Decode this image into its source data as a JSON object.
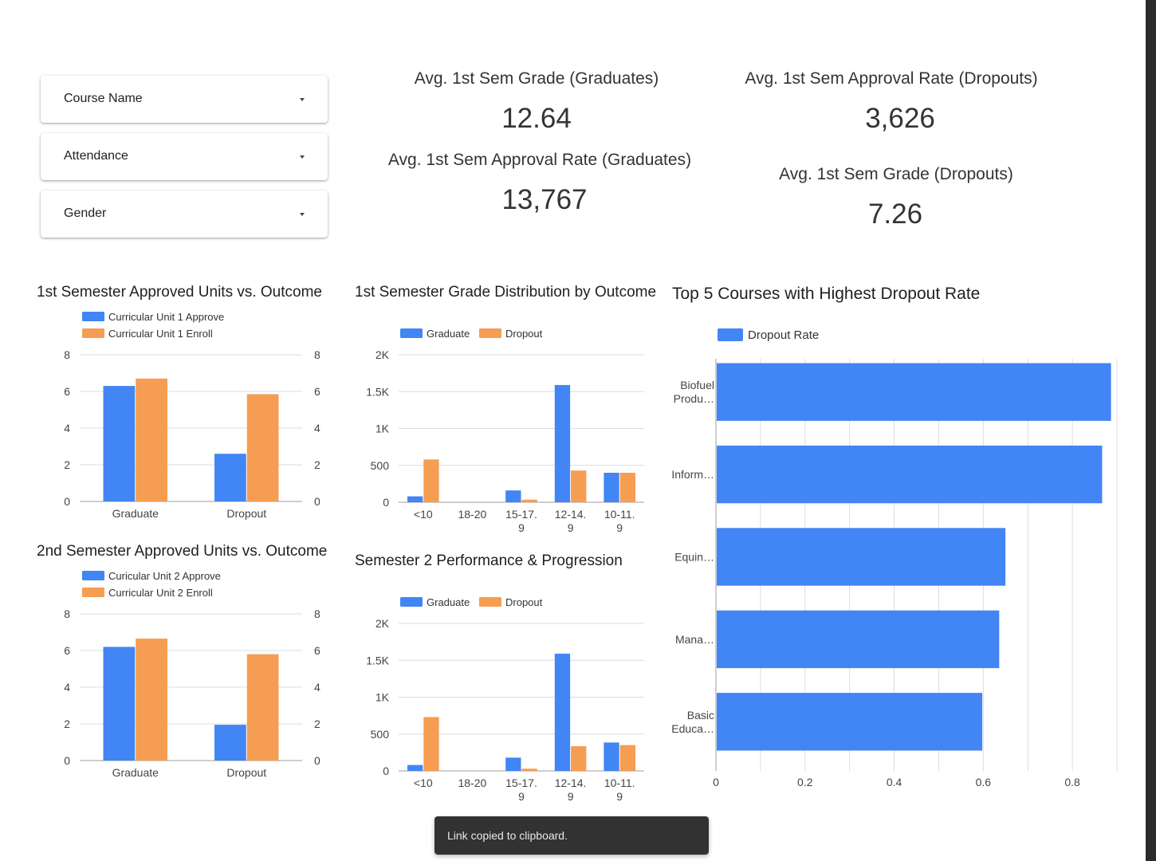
{
  "filters": [
    {
      "label": "Course Name"
    },
    {
      "label": "Attendance"
    },
    {
      "label": "Gender"
    }
  ],
  "scorecards": {
    "grad_grade": {
      "title": "Avg. 1st Sem Grade (Graduates)",
      "value": "12.64"
    },
    "grad_approval": {
      "title": "Avg. 1st Sem Approval Rate (Graduates)",
      "value": "13,767"
    },
    "drop_approval": {
      "title": "Avg. 1st Sem Approval Rate (Dropouts)",
      "value": "3,626"
    },
    "drop_grade": {
      "title": "Avg. 1st Sem Grade (Dropouts)",
      "value": "7.26"
    }
  },
  "colors": {
    "blue": "#4285f4",
    "orange": "#f59d52",
    "grid": "#dadce0",
    "axis": "#9e9e9e"
  },
  "chart_data": [
    {
      "id": "sem1_units",
      "type": "bar",
      "title": "1st Semester Approved Units vs. Outcome",
      "categories": [
        "Graduate",
        "Dropout"
      ],
      "series": [
        {
          "name": "Curricular Unit 1 Approve",
          "values": [
            6.3,
            2.6
          ]
        },
        {
          "name": "Curricular Unit 1 Enroll",
          "values": [
            6.7,
            5.85
          ]
        }
      ],
      "ylim": [
        0,
        8
      ],
      "yticks": [
        "0",
        "2",
        "4",
        "6",
        "8"
      ],
      "dual_axis": true
    },
    {
      "id": "sem1_grades",
      "type": "bar",
      "title": "1st Semester Grade Distribution by Outcome",
      "categories": [
        "<10",
        "18-20",
        "15-17.\n9",
        "12-14.\n9",
        "10-11.\n9"
      ],
      "series": [
        {
          "name": "Graduate",
          "values": [
            80,
            0,
            160,
            1590,
            400
          ]
        },
        {
          "name": "Dropout",
          "values": [
            580,
            0,
            35,
            430,
            400
          ]
        }
      ],
      "ylim": [
        0,
        2000
      ],
      "yticks": [
        "0",
        "500",
        "1K",
        "1.5K",
        "2K"
      ]
    },
    {
      "id": "sem2_units",
      "type": "bar",
      "title": "2nd Semester Approved Units vs. Outcome",
      "categories": [
        "Graduate",
        "Dropout"
      ],
      "series": [
        {
          "name": "Curicular Unit 2 Approve",
          "values": [
            6.2,
            1.95
          ]
        },
        {
          "name": "Curricular Unit 2 Enroll",
          "values": [
            6.65,
            5.8
          ]
        }
      ],
      "ylim": [
        0,
        8
      ],
      "yticks": [
        "0",
        "2",
        "4",
        "6",
        "8"
      ],
      "dual_axis": true
    },
    {
      "id": "sem2_perf",
      "type": "bar",
      "title": "Semester 2 Performance & Progression",
      "categories": [
        "<10",
        "18-20",
        "15-17.\n9",
        "12-14.\n9",
        "10-11.\n9"
      ],
      "series": [
        {
          "name": "Graduate",
          "values": [
            80,
            0,
            180,
            1590,
            385
          ]
        },
        {
          "name": "Dropout",
          "values": [
            730,
            0,
            30,
            335,
            350
          ]
        }
      ],
      "ylim": [
        0,
        2000
      ],
      "yticks": [
        "0",
        "500",
        "1K",
        "1.5K",
        "2K"
      ]
    },
    {
      "id": "dropout_top5",
      "type": "bar",
      "orientation": "horizontal",
      "title": "Top 5 Courses with Highest Dropout Rate",
      "categories": [
        "Biofuel\nProdu…",
        "Inform…",
        "Equin…",
        "Mana…",
        "Basic\nEduca…"
      ],
      "series": [
        {
          "name": "Dropout Rate",
          "values": [
            0.885,
            0.865,
            0.648,
            0.634,
            0.596
          ]
        }
      ],
      "xlim": [
        0,
        0.9
      ],
      "xticks": [
        "0",
        "0.2",
        "0.4",
        "0.6",
        "0.8"
      ]
    }
  ],
  "toast": {
    "message": "Link copied to clipboard."
  }
}
